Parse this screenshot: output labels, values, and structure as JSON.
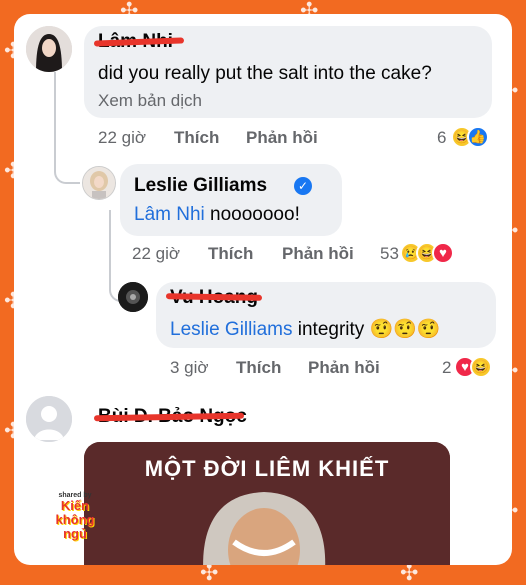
{
  "colors": {
    "frame": "#f26a21",
    "bubble": "#eef0f3",
    "mention": "#216fdb",
    "meta": "#65676b",
    "verified": "#1877f2",
    "scribble": "#e8352b",
    "meme_bg": "#5a2a2a"
  },
  "comments": [
    {
      "author": "Lâm Nhi",
      "author_scribbled": true,
      "text": "did you really put the salt into the cake?",
      "translate": "Xem bản dịch",
      "time": "22 giờ",
      "like": "Thích",
      "reply": "Phản hồi",
      "reaction_count": "6",
      "reactions": [
        "haha-icon",
        "like-icon"
      ]
    },
    {
      "author": "Leslie Gilliams",
      "verified": true,
      "mention": "Lâm Nhi",
      "text": " nooooooo!",
      "time": "22 giờ",
      "like": "Thích",
      "reply": "Phản hồi",
      "reaction_count": "53",
      "reactions": [
        "sad-icon",
        "haha-icon",
        "love-icon"
      ]
    },
    {
      "author": "Vu Hoang",
      "author_scribbled": true,
      "mention": "Leslie Gilliams",
      "text": " integrity",
      "emojis": "🤨🤨🤨",
      "time": "3 giờ",
      "like": "Thích",
      "reply": "Phản hồi",
      "reaction_count": "2",
      "reactions": [
        "love-icon",
        "haha-icon"
      ]
    },
    {
      "author": "Bùi D. Bảo Ngọc",
      "author_scribbled": true
    }
  ],
  "meme": {
    "caption": "MỘT ĐỜI LIÊM KHIẾT"
  },
  "watermark": {
    "small": "shared by",
    "line1": "Kiến",
    "line2": "không",
    "line3": "ngủ"
  }
}
